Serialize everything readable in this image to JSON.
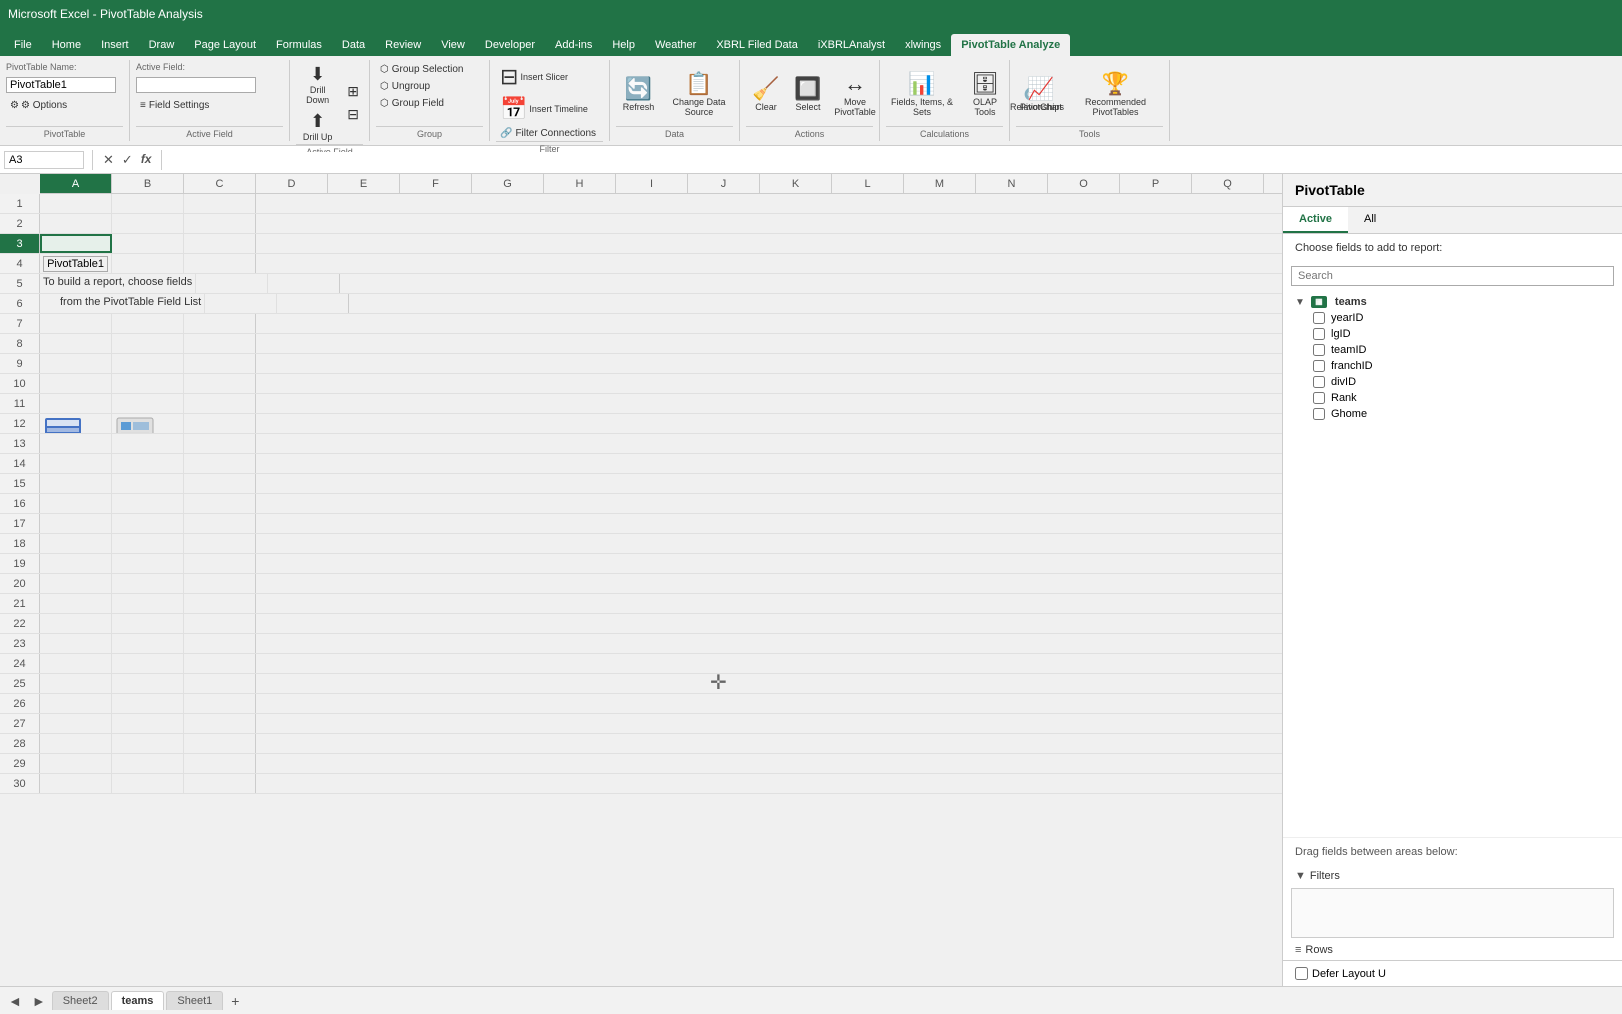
{
  "app": {
    "title": "Microsoft Excel - PivotTable Analysis"
  },
  "ribbon_tabs": [
    {
      "label": "File",
      "active": false
    },
    {
      "label": "Home",
      "active": false
    },
    {
      "label": "Insert",
      "active": false
    },
    {
      "label": "Draw",
      "active": false
    },
    {
      "label": "Page Layout",
      "active": false
    },
    {
      "label": "Formulas",
      "active": false
    },
    {
      "label": "Data",
      "active": false
    },
    {
      "label": "Review",
      "active": false
    },
    {
      "label": "View",
      "active": false
    },
    {
      "label": "Developer",
      "active": false
    },
    {
      "label": "Add-ins",
      "active": false
    },
    {
      "label": "Help",
      "active": false
    },
    {
      "label": "Weather",
      "active": false
    },
    {
      "label": "XBRL Filed Data",
      "active": false
    },
    {
      "label": "iXBRLAnalyst",
      "active": false
    },
    {
      "label": "xlwings",
      "active": false
    },
    {
      "label": "PivotTable Analyze",
      "active": true
    }
  ],
  "pivottable_name": {
    "label": "PivotTable Name:",
    "value": "PivotTable1"
  },
  "active_field": {
    "label": "Active Field:",
    "value": ""
  },
  "options_btn": "⚙ Options",
  "ribbon_groups": {
    "pivot_table": "PivotTable",
    "active_field_group": "Active Field",
    "group_group": "Group",
    "filter_group": "Filter",
    "data_group": "Data",
    "actions_group": "Actions",
    "calculations_group": "Calculations",
    "tools_group": "Tools"
  },
  "ribbon_buttons": {
    "field_settings": "Field Settings",
    "drill_down": "Drill Down",
    "drill_up": "Drill Up",
    "group_selection": "Group Selection",
    "ungroup": "Ungroup",
    "group_field": "Group Field",
    "insert_slicer": "Insert Slicer",
    "insert_timeline": "Insert Timeline",
    "filter_connections": "Filter Connections",
    "refresh": "Refresh",
    "change_data_source": "Change Data Source",
    "clear": "Clear",
    "select": "Select",
    "move_pivottable": "Move PivotTable",
    "fields_items_sets": "Fields, Items, & Sets",
    "olap_tools": "OLAP Tools",
    "relationships": "Relationships",
    "pivotchart": "PivotChart",
    "recommended_pivottables": "Recommended PivotTables"
  },
  "formula_bar": {
    "name_box": "A3",
    "formula": ""
  },
  "columns": [
    "A",
    "B",
    "C",
    "D",
    "E",
    "F",
    "G",
    "H",
    "I",
    "J",
    "K",
    "L",
    "M",
    "N",
    "O",
    "P",
    "Q"
  ],
  "rows": [
    1,
    2,
    3,
    4,
    5,
    6,
    7,
    8,
    9,
    10,
    11,
    12,
    13,
    14,
    15,
    16,
    17,
    18,
    19,
    20,
    21,
    22,
    23,
    24,
    25,
    26,
    27,
    28,
    29,
    30
  ],
  "pivot_placeholder": {
    "title": "PivotTable1",
    "text1": "To build a report, choose fields",
    "text2": "from the PivotTable Field List"
  },
  "pivot_panel": {
    "title": "PivotTable",
    "tab_active": "Active",
    "tab_all": "All",
    "choose_text": "Choose fields to add to report:",
    "search_placeholder": "Search",
    "fields": {
      "group": "teams",
      "items": [
        "yearID",
        "lgID",
        "teamID",
        "franchID",
        "divID",
        "Rank",
        "Ghome"
      ]
    },
    "drag_text": "Drag fields between areas below:",
    "filters_label": "Filters",
    "rows_label": "Rows",
    "defer_label": "Defer Layout U"
  },
  "sheet_tabs": [
    {
      "label": "Sheet2",
      "active": false
    },
    {
      "label": "teams",
      "active": true
    },
    {
      "label": "Sheet1",
      "active": false
    }
  ]
}
